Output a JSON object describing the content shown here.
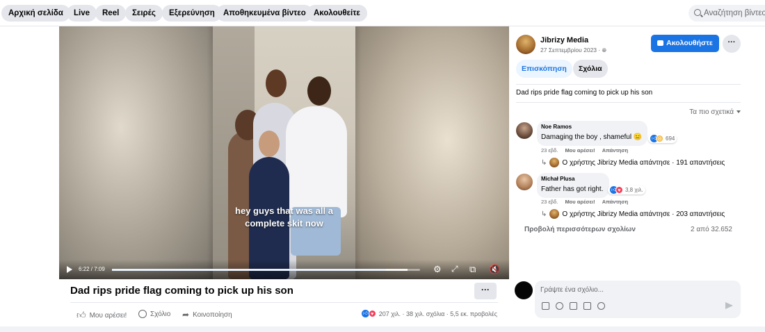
{
  "nav": {
    "pills": [
      "Αρχική σελίδα",
      "Live",
      "Reel",
      "Σειρές",
      "Εξερεύνηση",
      "Αποθηκευμένα βίντεο",
      "Ακολουθείτε"
    ],
    "search_placeholder": "Αναζήτηση βίντεο"
  },
  "video": {
    "caption_line1": "hey guys that was all a",
    "caption_line2": "complete skit now",
    "time": "6:22 / 7:09",
    "progress": 0.89,
    "buffered": 0.96
  },
  "post": {
    "title": "Dad rips pride flag coming to pick up his son",
    "more": "···",
    "actions": {
      "like": "Μου αρέσει!",
      "comment": "Σχόλιο",
      "share": "Κοινοποίηση"
    },
    "stats": "207 χιλ. · 38 χιλ. σχόλια · 5,5 εκ. προβολές"
  },
  "sidebar": {
    "page_name": "Jibrizy Media",
    "date": "27 Σεπτεμβρίου 2023 ·",
    "follow_label": "Ακολουθήστε",
    "dots": "···",
    "tabs": [
      "Επισκόπηση",
      "Σχόλια"
    ],
    "description": "Dad rips pride flag coming to pick up his son",
    "sort_label": "Τα πιο σχετικά"
  },
  "comments": [
    {
      "name": "Noe Ramos",
      "text": "Damaging the boy , shameful 😑",
      "reactions": "694",
      "age": "23 εβδ.",
      "like": "Μου αρέσει!",
      "reply": "Απάντηση",
      "replies": "Ο χρήστης Jibrizy Media απάντησε · 191 απαντήσεις"
    },
    {
      "name": "Michał Plusa",
      "text": "Father has got right.",
      "reactions": "3,8 χιλ.",
      "age": "23 εβδ.",
      "like": "Μου αρέσει!",
      "reply": "Απάντηση",
      "replies": "Ο χρήστης Jibrizy Media απάντησε · 203 απαντήσεις"
    }
  ],
  "more_comments": "Προβολή περισσότερων σχολίων",
  "comment_count": "2 από 32.652",
  "composer": {
    "placeholder": "Γράψτε ένα σχόλιο..."
  },
  "colors": {
    "accent": "#1b74e4",
    "love": "#f33e58",
    "haha": "#f7b125"
  }
}
